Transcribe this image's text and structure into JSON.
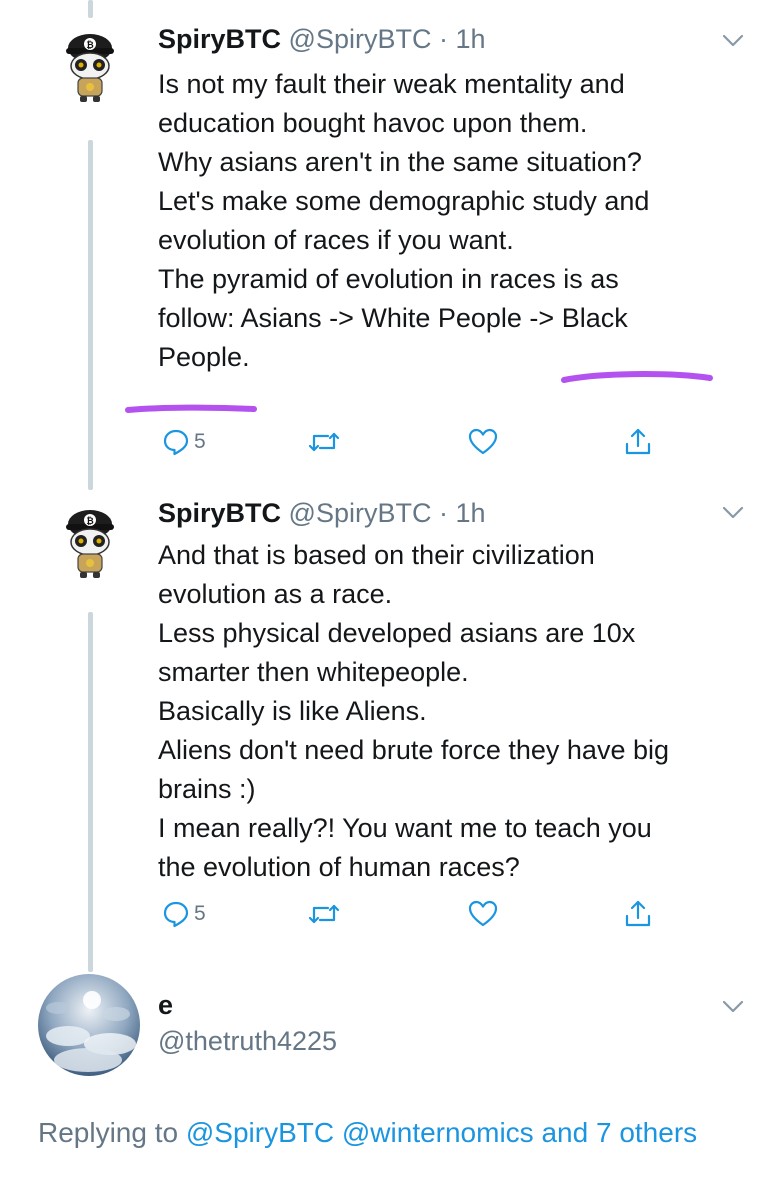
{
  "tweets": [
    {
      "name": "SpiryBTC",
      "handle": "@SpiryBTC",
      "time": "· 1h",
      "lines": [
        "Is not my fault their weak mentality and",
        "education bought havoc upon them.",
        "Why asians aren't in the same situation?",
        "",
        "Let's make some demographic study and",
        "evolution of races if you want.",
        "The pyramid of evolution in races is as",
        "follow: Asians -> White People -> Black",
        "People."
      ],
      "reply_count": "5",
      "highlight_color": "#b452f0"
    },
    {
      "name": "SpiryBTC",
      "handle": "@SpiryBTC",
      "time": "· 1h",
      "lines": [
        "And that is based on their civilization",
        "evolution as a race.",
        "Less physical developed asians are 10x",
        "smarter then whitepeople.",
        "Basically is like Aliens.",
        "Aliens don't need brute force they have big",
        "brains :)",
        "I mean really?! You want me to teach you",
        "the evolution of human races?"
      ],
      "reply_count": "5"
    }
  ],
  "reply_author": {
    "name": "e",
    "handle": "@thetruth4225"
  },
  "replying_to": {
    "prefix": "Replying to",
    "user1": "@SpiryBTC",
    "user2": "@winternomics",
    "suffix": "and 7 others"
  },
  "icons": {
    "reply": "reply-icon",
    "retweet": "retweet-icon",
    "like": "heart-icon",
    "share": "share-icon",
    "more": "chevron-down-icon"
  },
  "colors": {
    "link": "#1b95e0",
    "secondary_text": "#657786",
    "thread_line": "#ccd6dd",
    "annotation": "#b452f0"
  }
}
